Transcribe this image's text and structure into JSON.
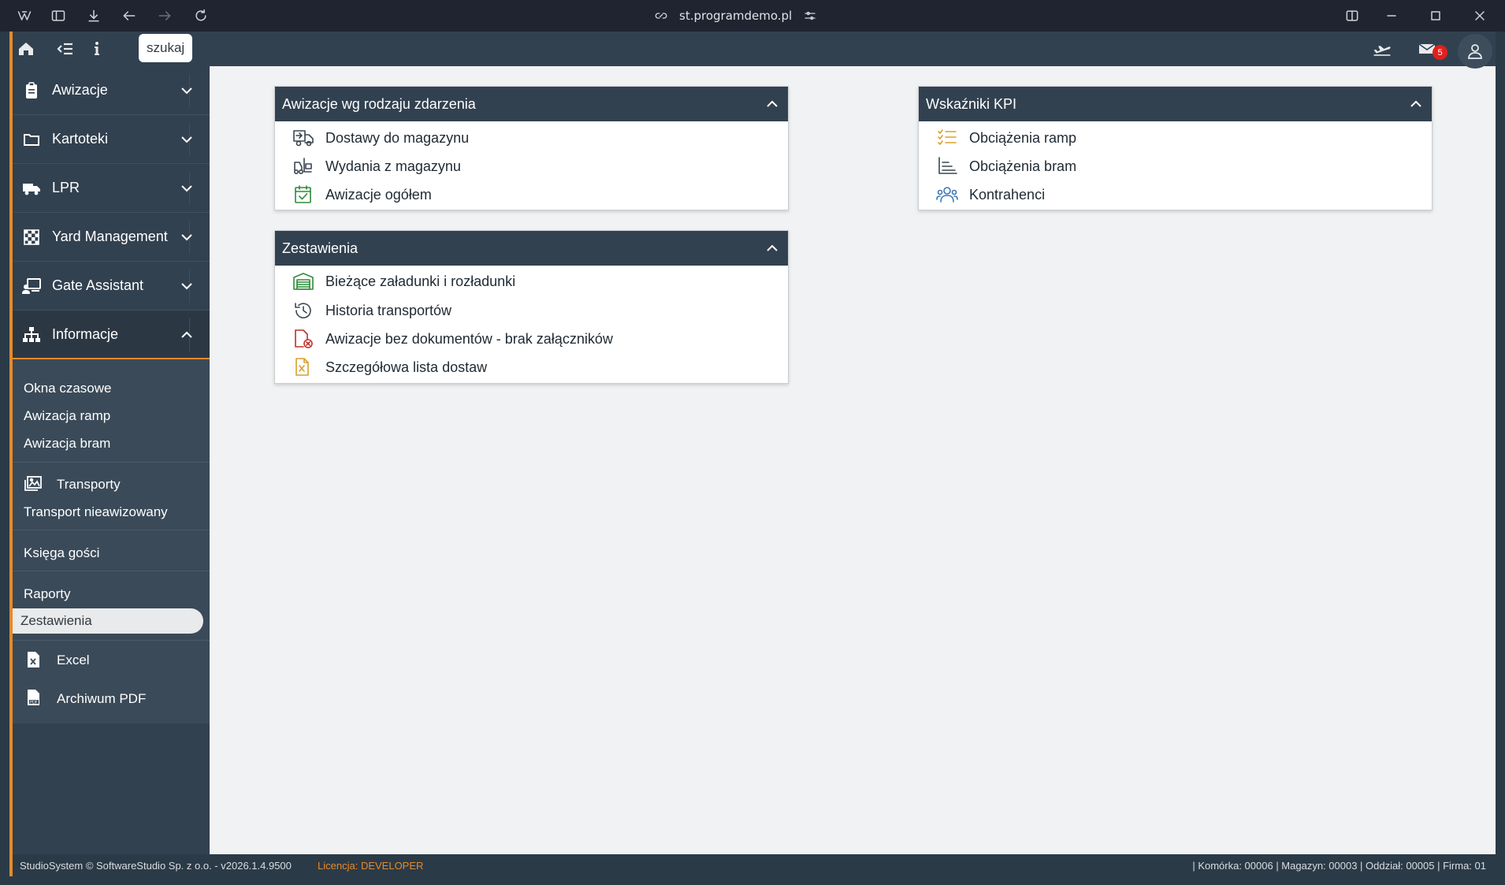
{
  "browser": {
    "url": "st.programdemo.pl"
  },
  "topbar": {
    "search_label": "szukaj",
    "mail_count": "5"
  },
  "sidebar": {
    "sections": [
      {
        "label": "Awizacje",
        "icon": "clipboard-icon"
      },
      {
        "label": "Kartoteki",
        "icon": "folder-icon"
      },
      {
        "label": "LPR",
        "icon": "truck-icon"
      },
      {
        "label": "Yard Management",
        "icon": "checkered-flag-icon"
      },
      {
        "label": "Gate Assistant",
        "icon": "gate-person-icon"
      },
      {
        "label": "Informacje",
        "icon": "sitemap-icon"
      }
    ],
    "sub_items": {
      "okna": "Okna czasowe",
      "ramp": "Awizacja ramp",
      "bram": "Awizacja bram",
      "transporty": "Transporty",
      "transport_nieawizowany": "Transport nieawizowany",
      "ksiega": "Księga gości",
      "raporty": "Raporty",
      "zestawienia": "Zestawienia",
      "excel": "Excel",
      "archiwum": "Archiwum PDF"
    }
  },
  "cards": {
    "awizacje": {
      "title": "Awizacje wg rodzaju zdarzenia",
      "rows": [
        "Dostawy do magazynu",
        "Wydania z magazynu",
        "Awizacje ogółem"
      ]
    },
    "zestawienia": {
      "title": "Zestawienia",
      "rows": [
        "Bieżące załadunki i rozładunki",
        "Historia transportów",
        "Awizacje bez dokumentów - brak załączników",
        "Szczegółowa lista dostaw"
      ]
    },
    "kpi": {
      "title": "Wskaźniki KPI",
      "rows": [
        "Obciążenia ramp",
        "Obciążenia bram",
        "Kontrahenci"
      ]
    }
  },
  "footer": {
    "copyright": "StudioSystem © SoftwareStudio Sp. z o.o. - v2026.1.4.9500",
    "license_label": "Licencja:",
    "license_value": "DEVELOPER",
    "status": "| Komórka: 00006 | Magazyn: 00003 | Oddział: 00005 | Firma: 01"
  },
  "colors": {
    "accent": "#e58a2b",
    "header": "#324150",
    "green_icon": "#2e8b3a",
    "red_icon": "#c0312b",
    "yellow_icon": "#d8a02a",
    "blue_icon": "#3a78b5"
  }
}
